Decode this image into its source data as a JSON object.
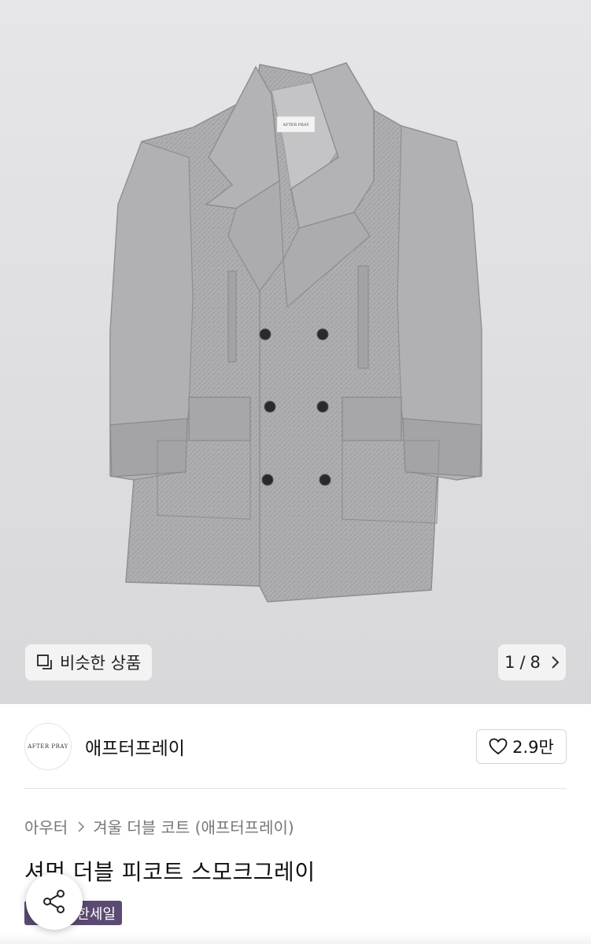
{
  "hero": {
    "coat_label_top": "AFTER PRAY",
    "similar_label": "비슷한 상품",
    "pager": {
      "current": "1",
      "separator": "/",
      "total": "8"
    }
  },
  "brand": {
    "logo_text": "AFTER PRAY",
    "name": "애프터프레이",
    "likes": "2.9만"
  },
  "breadcrumb": {
    "category": "아우터",
    "subcategory": "겨울 더블 코트 (애프터프레이)"
  },
  "product": {
    "title": "셔먼 더블 피코트 스모크그레이",
    "badge": "한세일"
  },
  "colors": {
    "coat": "#a9a9ab",
    "badge": "#5b4b73",
    "hero_bg": "#e0e0e2"
  },
  "icons": {
    "similar": "square-stack-icon",
    "pager": "chevron-right-icon",
    "like": "heart-outline-icon",
    "share": "share-icon"
  }
}
